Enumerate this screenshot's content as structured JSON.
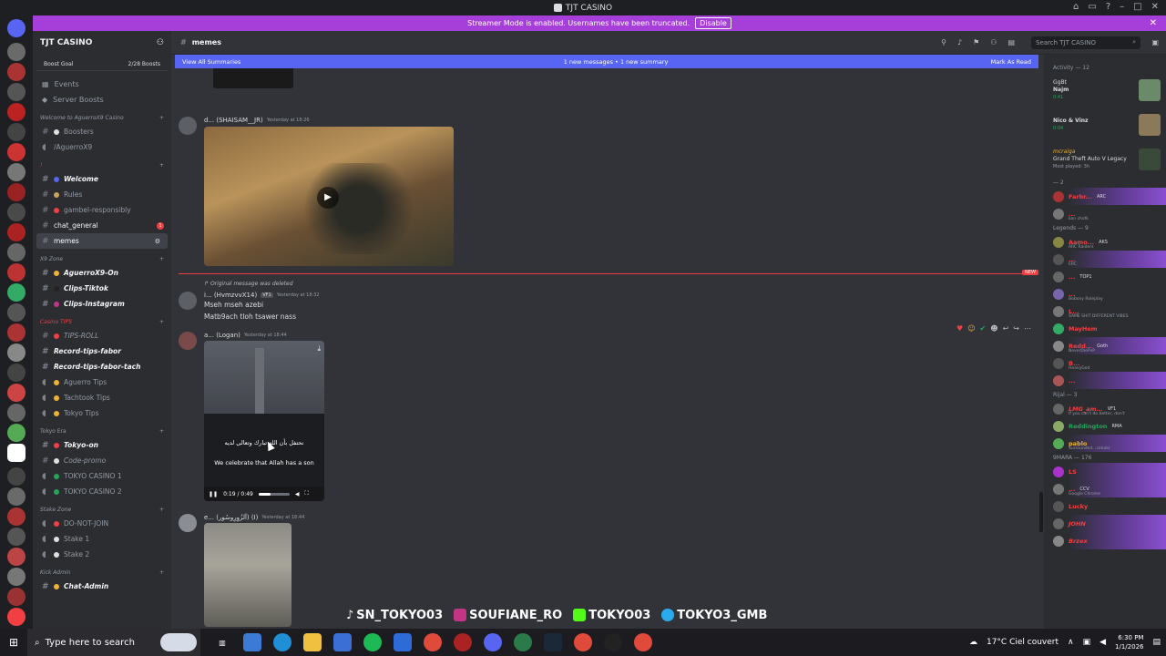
{
  "window": {
    "title": "TJT CASINO"
  },
  "banner": {
    "text": "Streamer Mode is enabled. Usernames have been truncated.",
    "disable_label": "Disable"
  },
  "server": {
    "name": "TJT CASINO",
    "boost_goal": "Boost Goal",
    "boost_count": "2/28 Boosts",
    "misc": [
      "Events",
      "Server Boosts"
    ]
  },
  "categories": {
    "welcome": "Welcome to AguerroX9 Casino",
    "important": "!",
    "x9zone": "X9 Zone",
    "casinotips": "Casino TIPS",
    "tokyoera": "Tokyo Era",
    "stakezone": "Stake Zone",
    "kickadmin": "Kick Admin"
  },
  "channels": {
    "boosters": "Boosters",
    "aguerrox9": "/AguerroX9",
    "welcome": "Welcome",
    "rules": "Rules",
    "gambel": "gambel-responsibly",
    "chat_general": "chat_general",
    "chat_general_unread": "1",
    "memes": "memes",
    "aguerrox9on": "AguerroX9-On",
    "clipstiktok": "Clips-Tiktok",
    "clipsinstagram": "Clips-Instagram",
    "tipsroll": "TIPS-ROLL",
    "recordfabor": "Record-tips-fabor",
    "recordfabortach": "Record-tips-fabor-tach",
    "aguerrotips": "Aguerro Tips",
    "tachtooktips": "Tachtook Tips",
    "tokyotips": "Tokyo Tips",
    "tokyoon": "Tokyo-on",
    "codepromo": "Code-promo",
    "tokyocasino1": "TOKYO CASINO 1",
    "tokyocasino2": "TOKYO CASINO 2",
    "donotjoin": "DO-NOT-JOIN",
    "stake1": "Stake 1",
    "stake2": "Stake 2",
    "chatadmin": "Chat-Admin"
  },
  "header": {
    "channel": "memes",
    "search_placeholder": "Search TJT CASINO"
  },
  "summaries": {
    "view_all": "View All Summaries",
    "center": "1 new messages  •  1 new summary",
    "mark_read": "Mark As Read"
  },
  "messages": {
    "m1": {
      "author": "d... (SHAISAM__JR)",
      "time": "Yesterday at 18:26"
    },
    "m2": {
      "reply": "Original message was deleted",
      "author": "i... (HvmzvvX14)",
      "tag": "VF1",
      "time": "Yesterday at 18:32",
      "line1": "Mseh mseh azebi",
      "line2": "Matb9ach tloh tsawer nass"
    },
    "m3": {
      "author": "a... (Logan)",
      "time": "Yesterday at 18:44",
      "caption_ar": "نحتفل بأن الله تبارك وتعالى لديه",
      "caption_en": "We celebrate that Allah has a son",
      "time_label": "0:19 / 0:49",
      "progress": 0.39
    },
    "m4": {
      "author": "e... (اَلزُوِرِوسُور) (I)",
      "time": "Yesterday at 18:44"
    },
    "new_tag": "NEW"
  },
  "members": {
    "activity_header": "Activity — 12",
    "activities": [
      {
        "top": "GgBt",
        "name": "Najm",
        "sub": "0:41"
      },
      {
        "top": "",
        "name": "Nico & Vinz",
        "sub": "0:04"
      },
      {
        "top": "mcraiga",
        "name": "Grand Theft Auto V Legacy",
        "sub": "Most played: 3h"
      }
    ],
    "sec_ii": "— 2",
    "sec_legends": "Legends — 9",
    "sec_rijal": "Rijal — 3",
    "sec_9mara": "9MARA — 176",
    "rows": [
      {
        "name": "Farbr...",
        "tag": "ARC",
        "sub": ""
      },
      {
        "name": "...",
        "tag": "",
        "sub": "kan chofk"
      },
      {
        "name": "Aamo...",
        "tag": "AKS",
        "sub": "ARC Raiders"
      },
      {
        "name": "...",
        "tag": "",
        "sub": "ERC"
      },
      {
        "name": "...",
        "tag": "TOP1",
        "sub": ""
      },
      {
        "name": "...",
        "tag": "",
        "sub": "Bobony Roleplay"
      },
      {
        "name": "L...",
        "tag": "",
        "sub": "SAME SHIT DIFFERENT VIBES"
      },
      {
        "name": "MayHem",
        "tag": "",
        "sub": ""
      },
      {
        "name": "Redd...",
        "tag": "Goth",
        "sub": "NeverDiePvP"
      },
      {
        "name": "B...",
        "tag": "",
        "sub": "HeavyGod"
      },
      {
        "name": "...",
        "tag": "",
        "sub": ""
      },
      {
        "name": "LMG_am...",
        "tag": "VF1",
        "sub": "If you can't do better, don't"
      },
      {
        "name": "Reddington",
        "tag": "RMA",
        "sub": ""
      },
      {
        "name": "pablo",
        "tag": "",
        "sub": "Surrounded...celular"
      },
      {
        "name": "LS",
        "tag": "",
        "sub": ""
      },
      {
        "name": "...",
        "tag": "CCV",
        "sub": "Google Chrome"
      },
      {
        "name": "Lucky",
        "tag": "",
        "sub": ""
      },
      {
        "name": "JOHN",
        "tag": "",
        "sub": ""
      },
      {
        "name": "Brzex",
        "tag": "",
        "sub": ""
      }
    ]
  },
  "overlay": {
    "tiktok": "SN_TOKYO03",
    "instagram": "SOUFIANE_RO",
    "kick": "TOKYO03",
    "telegram": "TOKYO3_GMB"
  },
  "taskbar": {
    "search_placeholder": "Type here to search",
    "weather": "17°C  Ciel couvert",
    "time": "6:30 PM",
    "date": "1/1/2026"
  },
  "colors": {
    "accent": "#5865f2",
    "banner": "#a63fd9",
    "danger": "#f23f43",
    "online": "#23a55a"
  }
}
